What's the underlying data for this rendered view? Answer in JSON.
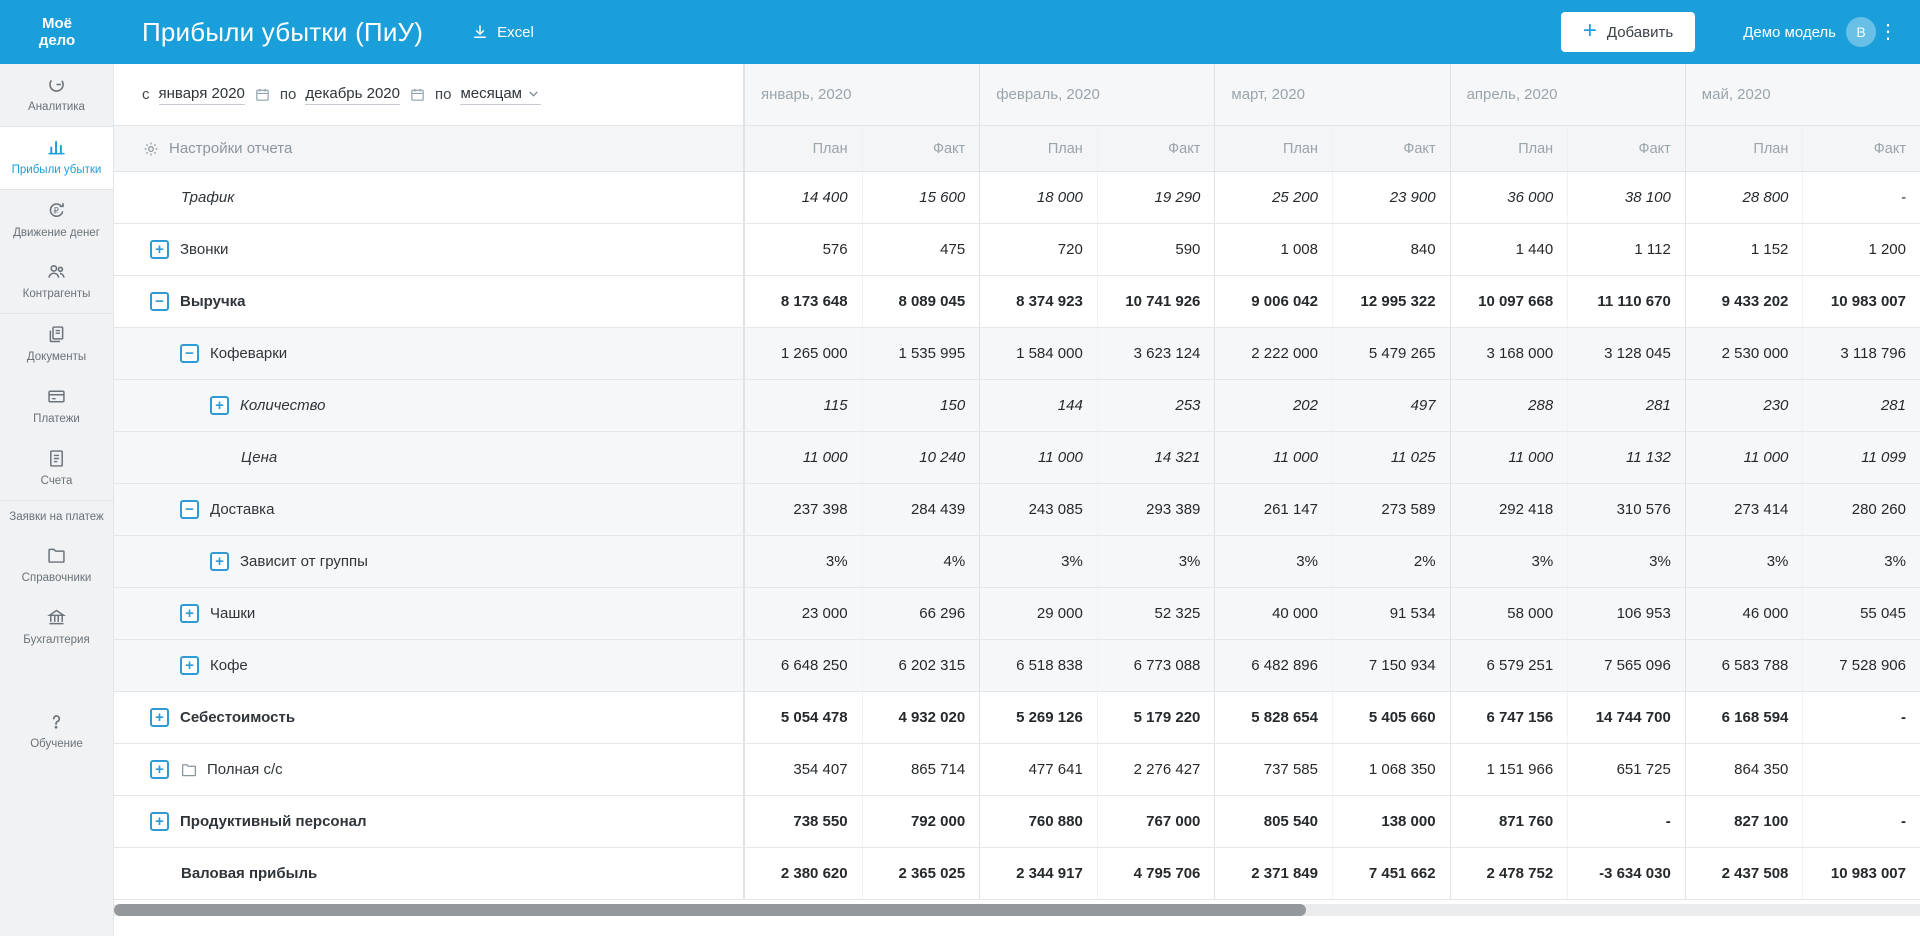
{
  "colors": {
    "accent": "#1a9fdb",
    "header_bg": "#1a9fdb"
  },
  "header": {
    "logo_line1": "Моё",
    "logo_line2": "дело",
    "title": "Прибыли убытки (ПиУ)",
    "excel_label": "Excel",
    "add_label": "Добавить",
    "user_label": "Демо модель",
    "avatar_letter": "В"
  },
  "sidebar": {
    "items": [
      {
        "label": "Аналитика",
        "icon": "analytics-icon",
        "active": false
      },
      {
        "label": "Прибыли убытки",
        "icon": "profit-loss-icon",
        "active": true
      },
      {
        "label": "Движение денег",
        "icon": "cash-flow-icon",
        "active": false
      },
      {
        "label": "Контрагенты",
        "icon": "contractors-icon",
        "active": false
      },
      {
        "label": "Документы",
        "icon": "documents-icon",
        "active": false
      },
      {
        "label": "Платежи",
        "icon": "payments-icon",
        "active": false
      },
      {
        "label": "Счета",
        "icon": "invoices-icon",
        "active": false
      },
      {
        "label": "Заявки на платеж",
        "icon": "payment-requests",
        "active": false
      },
      {
        "label": "Справочники",
        "icon": "directories-icon",
        "active": false
      },
      {
        "label": "Бухгалтерия",
        "icon": "accounting-icon",
        "active": false
      },
      {
        "label": "Обучение",
        "icon": "education-icon",
        "active": false
      }
    ]
  },
  "filters": {
    "from_label": "с",
    "from_value": "января 2020",
    "to_label": "по",
    "to_value": "декабрь 2020",
    "period_label": "по",
    "period_value": "месяцам",
    "settings_label": "Настройки отчета"
  },
  "table": {
    "months": [
      "январь, 2020",
      "февраль, 2020",
      "март, 2020",
      "апрель, 2020",
      "май, 2020"
    ],
    "plan_label": "План",
    "fact_label": "Факт",
    "rows": [
      {
        "label": "Трафик",
        "level": 0,
        "expander": "",
        "folder": false,
        "bold": false,
        "italic": true,
        "shaded": false,
        "values": [
          "14 400",
          "15 600",
          "18 000",
          "19 290",
          "25 200",
          "23 900",
          "36 000",
          "38 100",
          "28 800",
          "-"
        ]
      },
      {
        "label": "Звонки",
        "level": 0,
        "expander": "plus",
        "folder": false,
        "bold": false,
        "italic": false,
        "shaded": false,
        "values": [
          "576",
          "475",
          "720",
          "590",
          "1 008",
          "840",
          "1 440",
          "1 112",
          "1 152",
          "1 200"
        ]
      },
      {
        "label": "Выручка",
        "level": 0,
        "expander": "minus",
        "folder": false,
        "bold": true,
        "italic": false,
        "shaded": false,
        "values": [
          "8 173 648",
          "8 089 045",
          "8 374 923",
          "10 741 926",
          "9 006 042",
          "12 995 322",
          "10 097 668",
          "11 110 670",
          "9 433 202",
          "10 983 007"
        ]
      },
      {
        "label": "Кофеварки",
        "level": 1,
        "expander": "minus",
        "folder": false,
        "bold": false,
        "italic": false,
        "shaded": true,
        "values": [
          "1 265 000",
          "1 535 995",
          "1 584 000",
          "3 623 124",
          "2 222 000",
          "5 479 265",
          "3 168 000",
          "3 128 045",
          "2 530 000",
          "3 118 796"
        ]
      },
      {
        "label": "Количество",
        "level": 2,
        "expander": "plus",
        "folder": false,
        "bold": false,
        "italic": true,
        "shaded": true,
        "values": [
          "115",
          "150",
          "144",
          "253",
          "202",
          "497",
          "288",
          "281",
          "230",
          "281"
        ]
      },
      {
        "label": "Цена",
        "level": 2,
        "expander": "",
        "folder": false,
        "bold": false,
        "italic": true,
        "shaded": true,
        "values": [
          "11 000",
          "10 240",
          "11 000",
          "14 321",
          "11 000",
          "11 025",
          "11 000",
          "11 132",
          "11 000",
          "11 099"
        ]
      },
      {
        "label": "Доставка",
        "level": 1,
        "expander": "minus",
        "folder": false,
        "bold": false,
        "italic": false,
        "shaded": true,
        "values": [
          "237 398",
          "284 439",
          "243 085",
          "293 389",
          "261 147",
          "273 589",
          "292 418",
          "310 576",
          "273 414",
          "280 260"
        ]
      },
      {
        "label": "Зависит от группы",
        "level": 2,
        "expander": "plus",
        "folder": false,
        "bold": false,
        "italic": false,
        "shaded": true,
        "values": [
          "3%",
          "4%",
          "3%",
          "3%",
          "3%",
          "2%",
          "3%",
          "3%",
          "3%",
          "3%"
        ]
      },
      {
        "label": "Чашки",
        "level": 1,
        "expander": "plus",
        "folder": false,
        "bold": false,
        "italic": false,
        "shaded": true,
        "values": [
          "23 000",
          "66 296",
          "29 000",
          "52 325",
          "40 000",
          "91 534",
          "58 000",
          "106 953",
          "46 000",
          "55 045"
        ]
      },
      {
        "label": "Кофе",
        "level": 1,
        "expander": "plus",
        "folder": false,
        "bold": false,
        "italic": false,
        "shaded": true,
        "values": [
          "6 648 250",
          "6 202 315",
          "6 518 838",
          "6 773 088",
          "6 482 896",
          "7 150 934",
          "6 579 251",
          "7 565 096",
          "6 583 788",
          "7 528 906"
        ]
      },
      {
        "label": "Себестоимость",
        "level": 0,
        "expander": "plus",
        "folder": false,
        "bold": true,
        "italic": false,
        "shaded": false,
        "values": [
          "5 054 478",
          "4 932 020",
          "5 269 126",
          "5 179 220",
          "5 828 654",
          "5 405 660",
          "6 747 156",
          "14 744 700",
          "6 168 594",
          "-"
        ]
      },
      {
        "label": "Полная с/с",
        "level": 0,
        "expander": "plus",
        "folder": true,
        "bold": false,
        "italic": false,
        "shaded": false,
        "values": [
          "354 407",
          "865 714",
          "477 641",
          "2 276 427",
          "737 585",
          "1 068 350",
          "1 151 966",
          "651 725",
          "864 350",
          ""
        ]
      },
      {
        "label": "Продуктивный персонал",
        "level": 0,
        "expander": "plus",
        "folder": false,
        "bold": true,
        "italic": false,
        "shaded": false,
        "values": [
          "738 550",
          "792 000",
          "760 880",
          "767 000",
          "805 540",
          "138 000",
          "871 760",
          "-",
          "827 100",
          "-"
        ]
      },
      {
        "label": "Валовая прибыль",
        "level": 0,
        "expander": "",
        "folder": false,
        "bold": true,
        "italic": false,
        "shaded": false,
        "values": [
          "2 380 620",
          "2 365 025",
          "2 344 917",
          "4 795 706",
          "2 371 849",
          "7 451 662",
          "2 478 752",
          "-3 634 030",
          "2 437 508",
          "10 983 007"
        ]
      }
    ]
  }
}
